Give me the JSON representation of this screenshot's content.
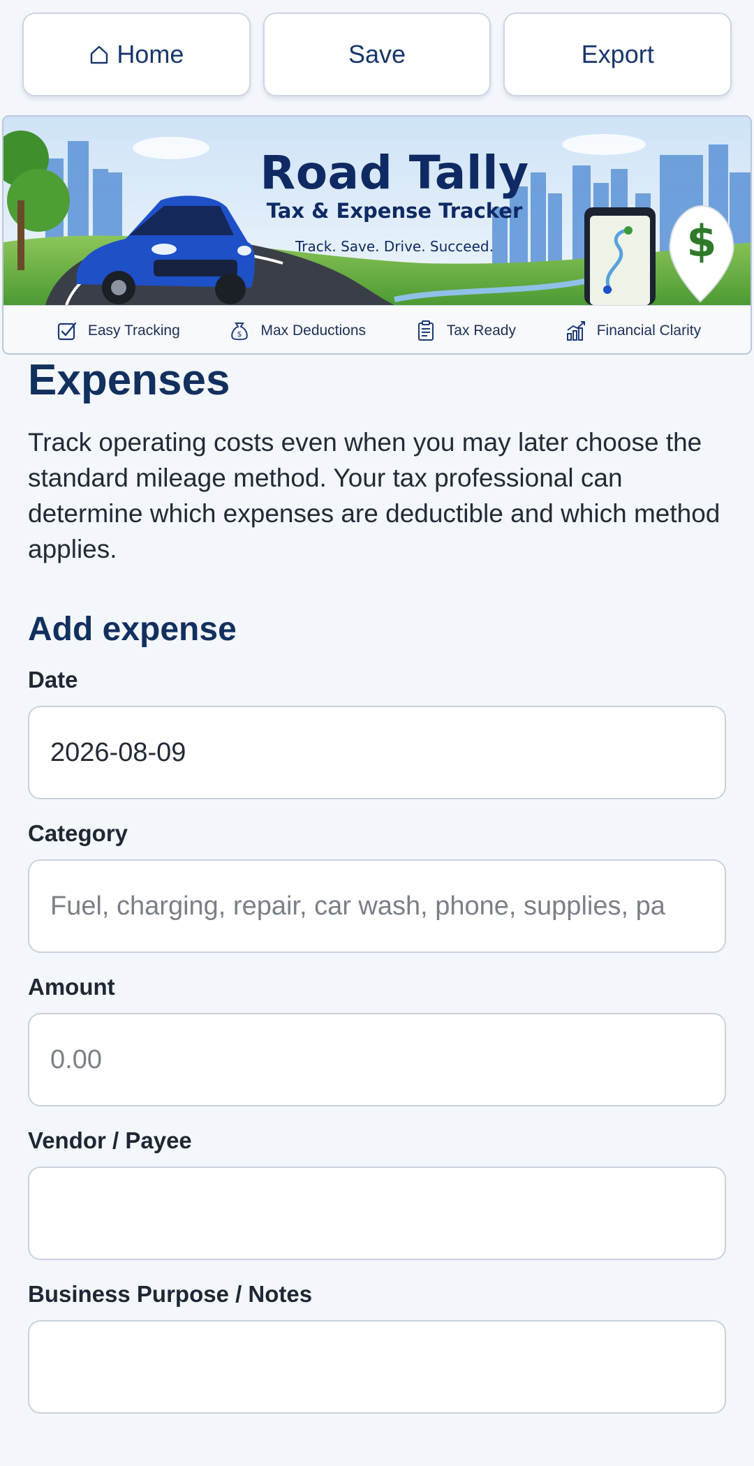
{
  "nav": {
    "home_label": "Home",
    "save_label": "Save",
    "export_label": "Export"
  },
  "banner": {
    "title": "Road Tally",
    "subtitle": "Tax & Expense Tracker",
    "tagline": "Track. Save. Drive. Succeed.",
    "features": [
      {
        "label": "Easy Tracking",
        "icon": "checkbox-icon"
      },
      {
        "label": "Max Deductions",
        "icon": "money-bag-icon"
      },
      {
        "label": "Tax Ready",
        "icon": "clipboard-icon"
      },
      {
        "label": "Financial Clarity",
        "icon": "growth-chart-icon"
      }
    ]
  },
  "page": {
    "title": "Expenses",
    "intro": "Track operating costs even when you may later choose the standard mileage method. Your tax professional can determine which expenses are deductible and which method applies."
  },
  "form": {
    "section_title": "Add expense",
    "date": {
      "label": "Date",
      "value": "2026-08-09"
    },
    "category": {
      "label": "Category",
      "placeholder": "Fuel, charging, repair, car wash, phone, supplies, pa"
    },
    "amount": {
      "label": "Amount",
      "placeholder": "0.00"
    },
    "vendor": {
      "label": "Vendor / Payee",
      "value": ""
    },
    "notes": {
      "label": "Business Purpose / Notes",
      "value": ""
    }
  },
  "colors": {
    "brand_navy": "#12305e",
    "page_bg": "#f3f6fb",
    "field_border": "#c9d1dc"
  }
}
